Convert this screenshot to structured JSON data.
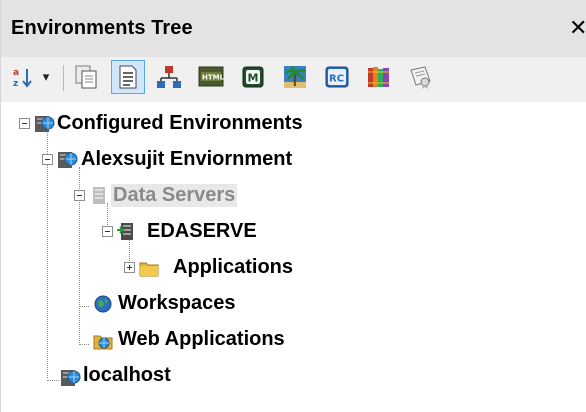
{
  "panel": {
    "title": "Environments Tree",
    "close_glyph": "✕"
  },
  "toolbar": {
    "buttons": [
      {
        "name": "sort-icon",
        "glyph": "a→z"
      },
      {
        "name": "dropdown-arrow-icon",
        "glyph": "▾"
      },
      {
        "name": "copy-pages-icon"
      },
      {
        "name": "document-icon",
        "active": true
      },
      {
        "name": "network-icon"
      },
      {
        "name": "html-icon",
        "glyph": "HTML"
      },
      {
        "name": "m-icon",
        "glyph": "M"
      },
      {
        "name": "palm-tree-icon"
      },
      {
        "name": "rc-icon",
        "glyph": "RC"
      },
      {
        "name": "books-icon"
      },
      {
        "name": "certificate-icon"
      }
    ]
  },
  "tree": {
    "root": {
      "label": "Configured Environments"
    },
    "environment": {
      "label": "Alexsujit Enviornment"
    },
    "data_servers": {
      "label": "Data Servers"
    },
    "edaserve": {
      "label": "EDASERVE"
    },
    "applications": {
      "label": "Applications"
    },
    "workspaces": {
      "label": "Workspaces"
    },
    "web_applications": {
      "label": "Web Applications"
    },
    "localhost": {
      "label": "localhost"
    }
  },
  "colors": {
    "titlebar_bg": "#e3e3e3",
    "toolbar_bg": "#f0f0f0",
    "active_button_bg": "#cfe6fb",
    "active_button_border": "#5fa7e8",
    "selected_node_bg": "#e8e8e8",
    "selected_node_text": "#8a8a8a"
  }
}
